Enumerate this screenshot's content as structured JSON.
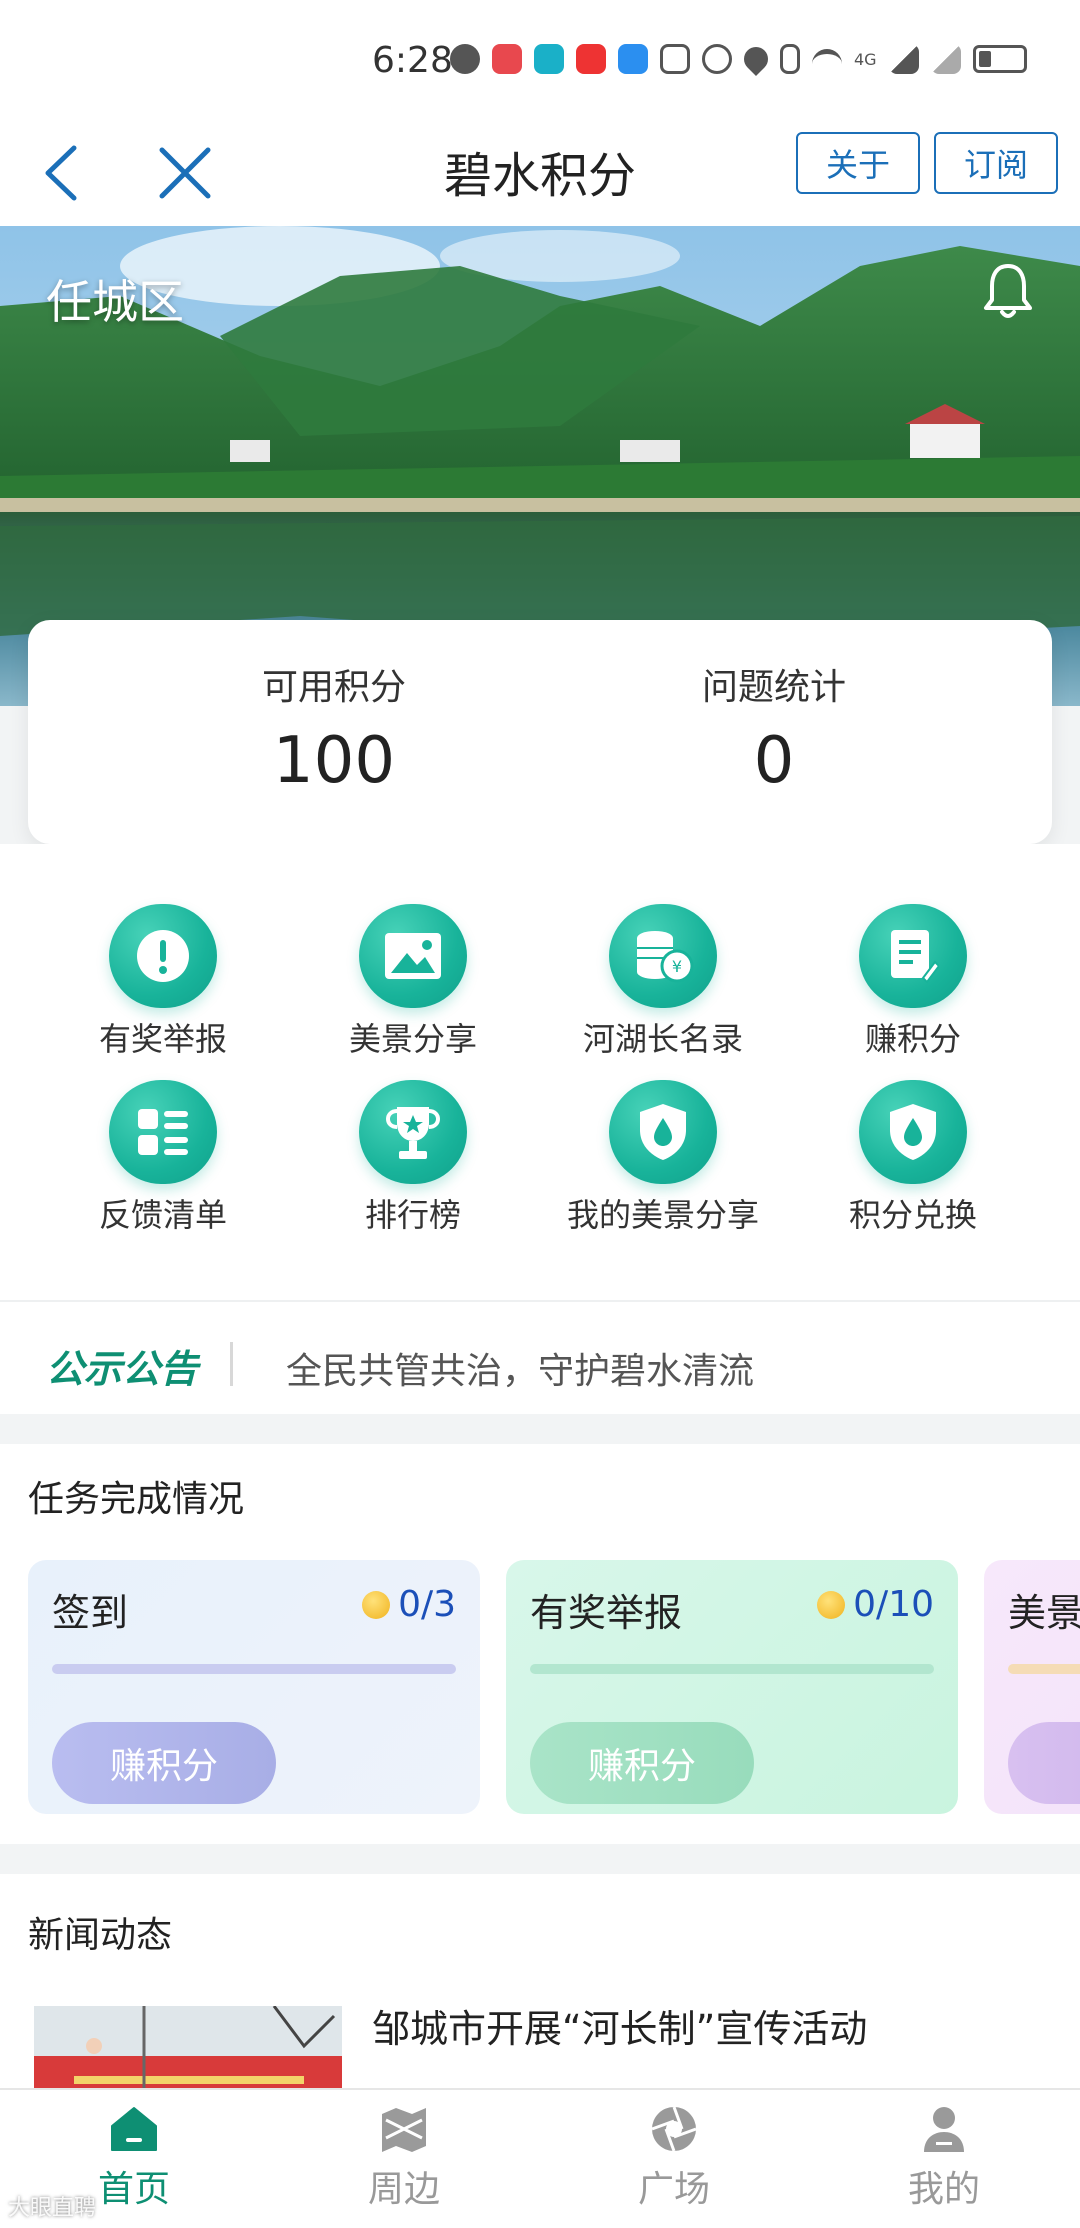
{
  "status_bar": {
    "time": "6:28",
    "network": "4G"
  },
  "nav": {
    "title": "碧水积分",
    "about_label": "关于",
    "subscribe_label": "订阅"
  },
  "hero": {
    "region": "任城区"
  },
  "stats": [
    {
      "label": "可用积分",
      "value": "100"
    },
    {
      "label": "问题统计",
      "value": "0"
    }
  ],
  "menu": [
    {
      "label": "有奖举报",
      "icon": "exclamation-icon"
    },
    {
      "label": "美景分享",
      "icon": "image-icon"
    },
    {
      "label": "河湖长名录",
      "icon": "coins-icon"
    },
    {
      "label": "赚积分",
      "icon": "document-edit-icon"
    },
    {
      "label": "反馈清单",
      "icon": "list-icon"
    },
    {
      "label": "排行榜",
      "icon": "trophy-icon"
    },
    {
      "label": "我的美景分享",
      "icon": "shield-drop-icon"
    },
    {
      "label": "积分兑换",
      "icon": "shield-drop-icon"
    }
  ],
  "notice": {
    "tag": "公示公告",
    "text": "全民共管共治，守护碧水清流"
  },
  "tasks": {
    "title": "任务完成情况",
    "items": [
      {
        "name": "签到",
        "progress": "0/3",
        "button": "赚积分"
      },
      {
        "name": "有奖举报",
        "progress": "0/10",
        "button": "赚积分"
      },
      {
        "name": "美景",
        "button": "赚"
      }
    ]
  },
  "news": {
    "title": "新闻动态",
    "headline": "邹城市开展“河长制”宣传活动"
  },
  "tabbar": [
    {
      "label": "首页",
      "icon": "home-icon"
    },
    {
      "label": "周边",
      "icon": "map-icon"
    },
    {
      "label": "广场",
      "icon": "aperture-icon"
    },
    {
      "label": "我的",
      "icon": "user-icon"
    }
  ],
  "watermark": "大眼直聘",
  "colors": {
    "accent": "#1b6fb8",
    "green": "#18b39a",
    "tab_active": "#0e8f73"
  }
}
